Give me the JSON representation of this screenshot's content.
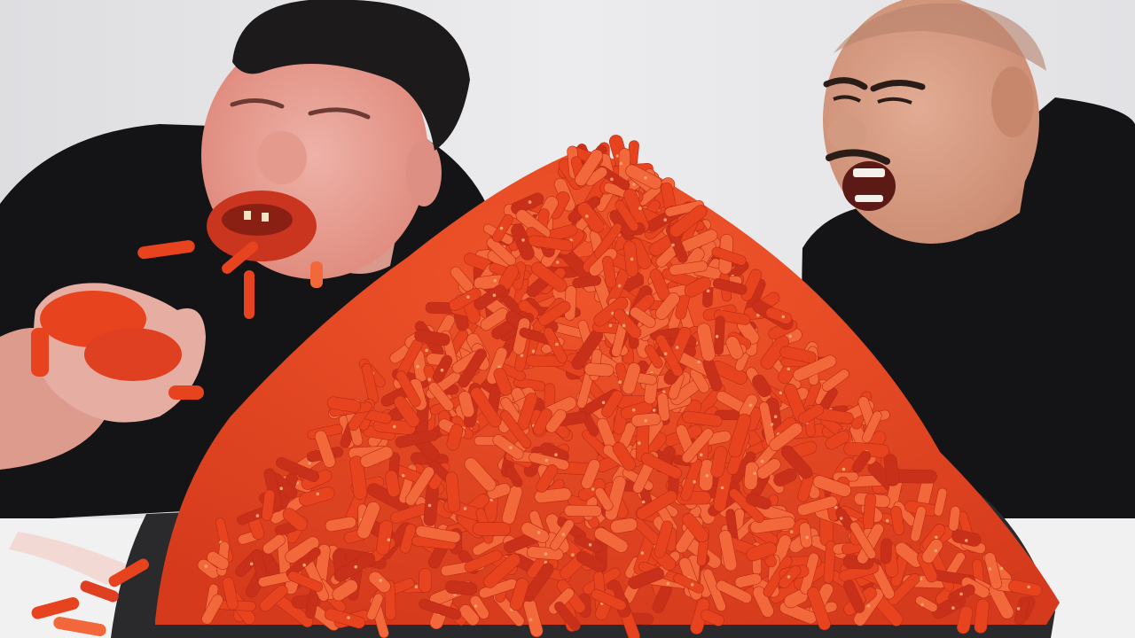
{
  "colors": {
    "wall": "#e9e9eb",
    "wall_shadow": "#d6d6d9",
    "table": "#f2f1f1",
    "tray": "#2a2a2c",
    "shirt": "#141416",
    "skin_left": "#e8a9a0",
    "skin_flushed": "#e07a6e",
    "skin_right": "#d59b83",
    "hair": "#1c1a1a",
    "snack_base": "#e8431f",
    "snack_light": "#f2683a",
    "snack_dark": "#c9301a",
    "snack_dust": "#f7a06a"
  },
  "snack_pile": {
    "piece_count": 900
  }
}
